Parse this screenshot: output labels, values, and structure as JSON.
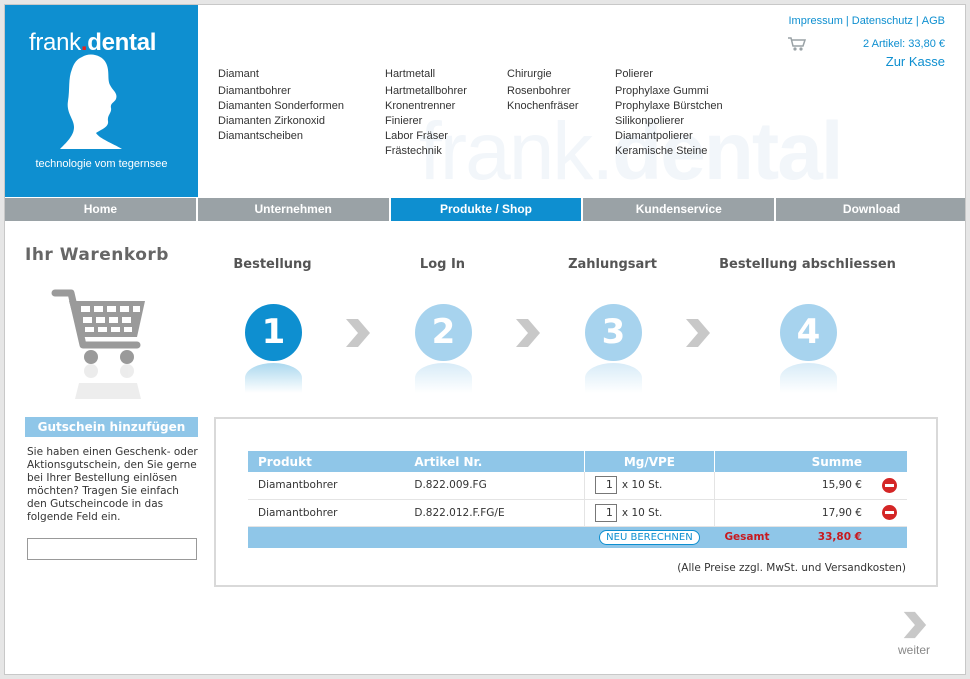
{
  "brand": {
    "name_light": "frank",
    "name_bold": "dental",
    "dot": ".",
    "tagline": "technologie vom tegernsee",
    "color": "#0e8fd0",
    "accent": "#e32320"
  },
  "toplinks": [
    "Impressum",
    "Datenschutz",
    "AGB"
  ],
  "cart_summary": {
    "items": "2 Artikel: 33,80 €",
    "checkout": "Zur Kasse"
  },
  "product_columns": [
    {
      "head": "Diamant",
      "items": [
        "Diamantbohrer",
        "Diamanten Sonderformen",
        "Diamanten Zirkonoxid",
        "Diamantscheiben"
      ]
    },
    {
      "head": "Hartmetall",
      "items": [
        "Hartmetallbohrer",
        "Kronentrenner",
        "Finierer",
        "Labor Fräser",
        "Frästechnik"
      ]
    },
    {
      "head": "Chirurgie",
      "items": [
        "Rosenbohrer",
        "Knochenfräser"
      ]
    },
    {
      "head": "Polierer",
      "items": [
        "Prophylaxe Gummi",
        "Prophylaxe Bürstchen",
        "Silikonpolierer",
        "Diamantpolierer",
        "Keramische Steine"
      ]
    }
  ],
  "nav": [
    {
      "label": "Home",
      "active": false
    },
    {
      "label": "Unternehmen",
      "active": false
    },
    {
      "label": "Produkte / Shop",
      "active": true
    },
    {
      "label": "Kundenservice",
      "active": false
    },
    {
      "label": "Download",
      "active": false
    }
  ],
  "sidebar": {
    "title": "Ihr Warenkorb",
    "voucher_title": "Gutschein hinzufügen",
    "voucher_text": "Sie haben einen Geschenk- oder Aktionsgutschein, den Sie gerne bei Ihrer Bestellung einlösen möchten? Tragen Sie einfach den Gutscheincode in das folgende Feld ein.",
    "voucher_value": ""
  },
  "steps": [
    {
      "label": "Bestellung",
      "number": "1",
      "active": true
    },
    {
      "label": "Log In",
      "number": "2",
      "active": false
    },
    {
      "label": "Zahlungsart",
      "number": "3",
      "active": false
    },
    {
      "label": "Bestellung abschliessen",
      "number": "4",
      "active": false
    }
  ],
  "cart_table": {
    "headers": {
      "product": "Produkt",
      "article": "Artikel Nr.",
      "qty": "Mg/VPE",
      "sum": "Summe"
    },
    "rows": [
      {
        "product": "Diamantbohrer",
        "article": "D.822.009.FG",
        "qty": "1",
        "unit": "x 10 St.",
        "sum": "15,90 €"
      },
      {
        "product": "Diamantbohrer",
        "article": "D.822.012.F.FG/E",
        "qty": "1",
        "unit": "x 10 St.",
        "sum": "17,90 €"
      }
    ],
    "recalc_label": "NEU BERECHNEN",
    "total_label": "Gesamt",
    "total_value": "33,80 €",
    "note": "(Alle Preise zzgl. MwSt. und Versandkosten)"
  },
  "next": {
    "label": "weiter"
  }
}
